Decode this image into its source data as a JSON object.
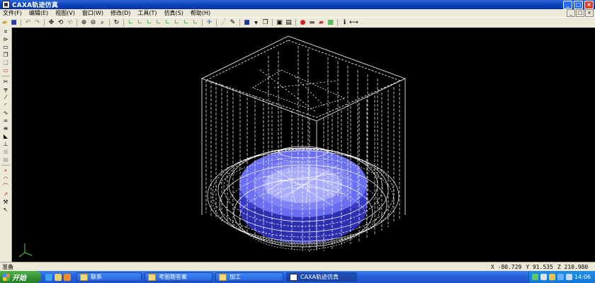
{
  "window": {
    "title": "CAXA轨迹仿真",
    "minimize": "_",
    "maximize": "□",
    "close": "×"
  },
  "menu": [
    "文件(F)",
    "编辑(E)",
    "视图(V)",
    "窗口(W)",
    "修改(D)",
    "工具(T)",
    "仿真(S)",
    "帮助(H)"
  ],
  "mdi_controls": [
    "_",
    "□",
    "×"
  ],
  "toolbar_icons": [
    "open-icon",
    "save-icon",
    "undo-icon",
    "redo-icon",
    "pan-icon",
    "rotate-icon",
    "zoom-in-icon",
    "zoom-out-icon",
    "zoom-window-icon",
    "refresh-icon",
    "axis-icon",
    "move-icon",
    "cube-icon",
    "box-icon",
    "view-icon",
    "simulate-icon",
    "shade-icon",
    "color-icon",
    "info-icon",
    "measure-icon"
  ],
  "left_tool_icons": [
    "crop-icon",
    "select-icon",
    "rectangle-icon",
    "copy-icon",
    "paste-icon",
    "cut-icon",
    "trim-icon",
    "line-icon",
    "arc-icon",
    "spline-icon",
    "point-icon",
    "circle-icon",
    "arrow-icon",
    "pointer-icon"
  ],
  "status": {
    "text": "准备",
    "x": "X -80.729",
    "y": "Y 91.535",
    "z": "Z 210.980"
  },
  "taskbar": {
    "start": "开始",
    "tasks": [
      {
        "label": "联系",
        "icon": "folder"
      },
      {
        "label": "考图题答案",
        "icon": "folder"
      },
      {
        "label": "加工",
        "icon": "folder"
      },
      {
        "label": "CAXA轨迹仿真",
        "icon": "app"
      }
    ],
    "clock": "14:06"
  },
  "colors": {
    "viewport_bg": "#000000",
    "part": "#6a6ef0",
    "wire": "#ffffff"
  }
}
